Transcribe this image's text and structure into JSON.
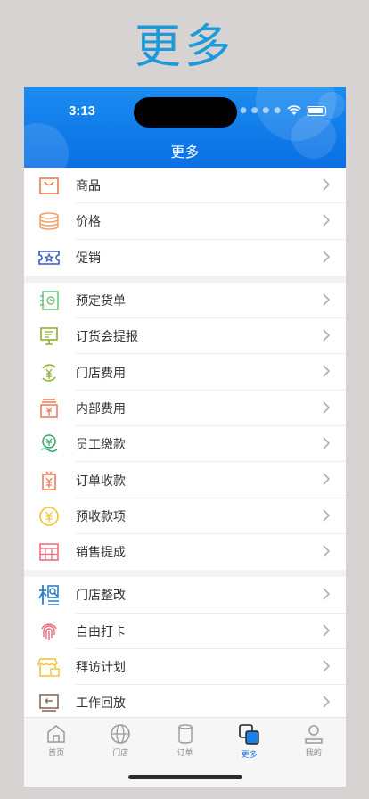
{
  "promo": {
    "title": "更多"
  },
  "status": {
    "time": "3:13"
  },
  "nav": {
    "title": "更多"
  },
  "groups": [
    {
      "items": [
        {
          "label": "商品",
          "icon": "shopping-bag-icon"
        },
        {
          "label": "价格",
          "icon": "coin-stack-icon"
        },
        {
          "label": "促销",
          "icon": "ticket-icon"
        }
      ]
    },
    {
      "items": [
        {
          "label": "预定货单",
          "icon": "clock-document-icon"
        },
        {
          "label": "订货会提报",
          "icon": "presentation-board-icon"
        },
        {
          "label": "门店费用",
          "icon": "yuan-cycle-icon"
        },
        {
          "label": "内部费用",
          "icon": "yuan-box-icon"
        },
        {
          "label": "员工缴款",
          "icon": "yuan-hand-icon"
        },
        {
          "label": "订单收款",
          "icon": "yuan-bag-icon"
        },
        {
          "label": "预收款项",
          "icon": "yuan-circle-icon"
        },
        {
          "label": "销售提成",
          "icon": "calculator-icon"
        }
      ]
    },
    {
      "items": [
        {
          "label": "门店整改",
          "icon": "inspect-icon"
        },
        {
          "label": "自由打卡",
          "icon": "fingerprint-icon"
        },
        {
          "label": "拜访计划",
          "icon": "shop-calendar-icon"
        },
        {
          "label": "工作回放",
          "icon": "replay-icon"
        }
      ]
    }
  ],
  "tabs": [
    {
      "label": "首页",
      "icon": "home-icon",
      "active": false
    },
    {
      "label": "门店",
      "icon": "globe-icon",
      "active": false
    },
    {
      "label": "订单",
      "icon": "cylinder-icon",
      "active": false
    },
    {
      "label": "更多",
      "icon": "more-squares-icon",
      "active": true
    },
    {
      "label": "我的",
      "icon": "person-icon",
      "active": false
    }
  ]
}
